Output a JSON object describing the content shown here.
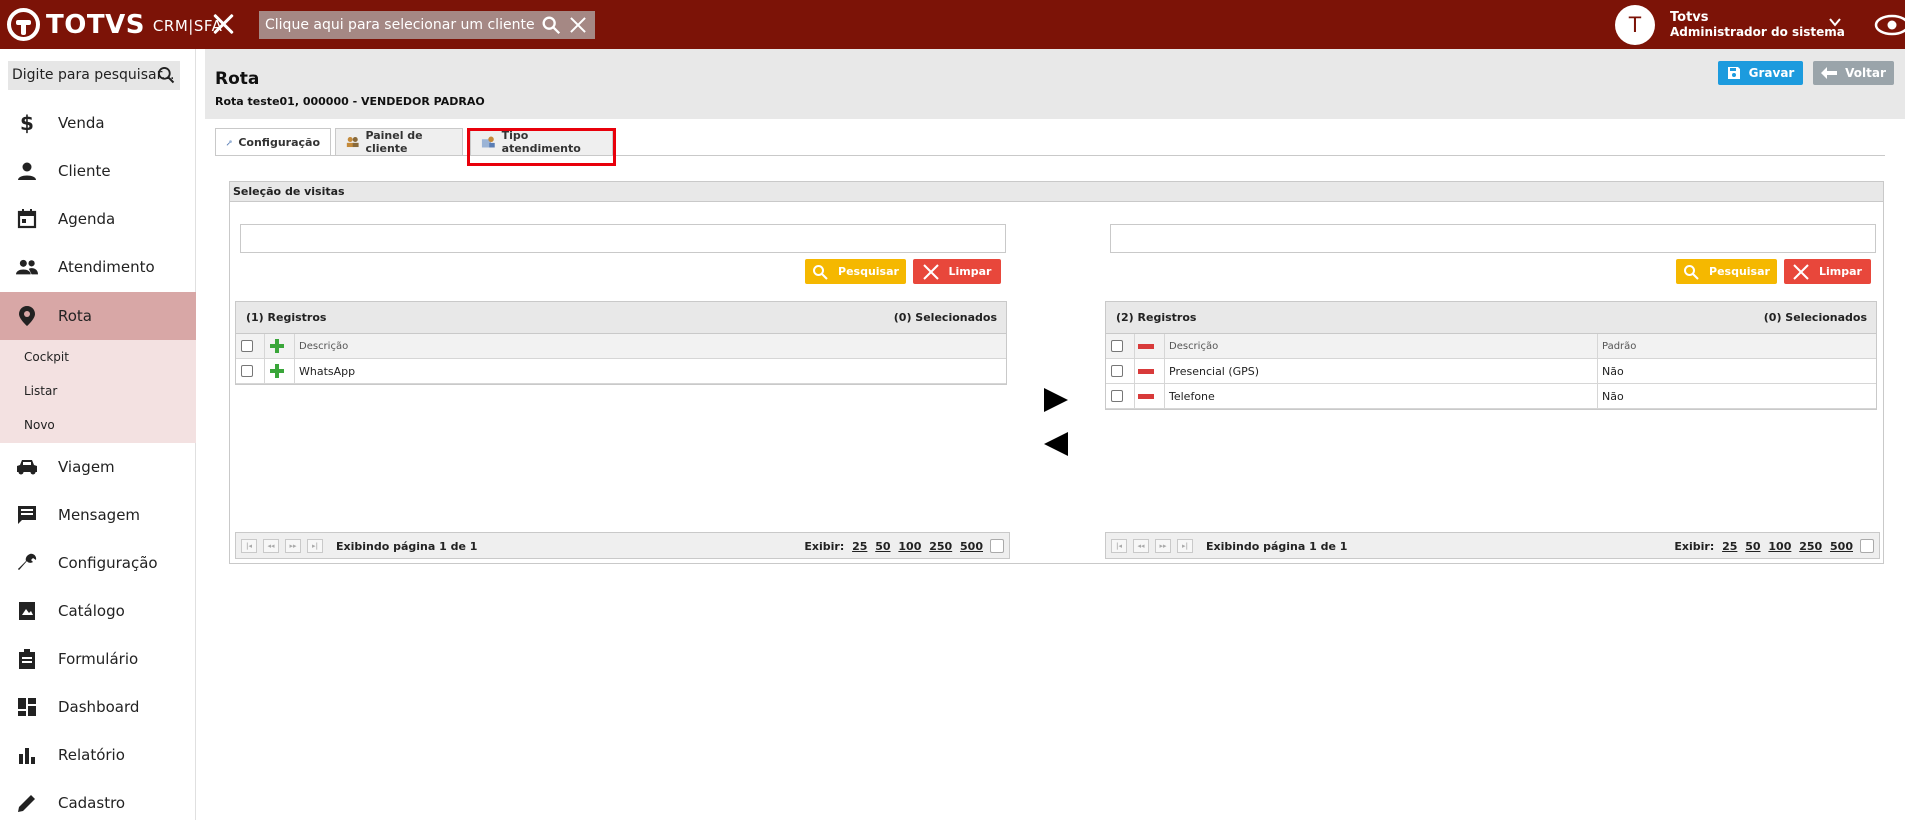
{
  "topbar": {
    "brand": "TOTVS",
    "brand_sub": "CRM|SFA",
    "client_placeholder": "Clique aqui para selecionar um cliente",
    "user_initial": "T",
    "user_name": "Totvs",
    "user_role": "Administrador do sistema"
  },
  "sidebar": {
    "search_placeholder": "Digite para pesquisar...",
    "items": [
      {
        "label": "Venda",
        "icon": "dollar-icon"
      },
      {
        "label": "Cliente",
        "icon": "person-icon"
      },
      {
        "label": "Agenda",
        "icon": "calendar-icon"
      },
      {
        "label": "Atendimento",
        "icon": "people-icon"
      },
      {
        "label": "Rota",
        "icon": "location-pin-icon"
      },
      {
        "label": "Viagem",
        "icon": "car-icon"
      },
      {
        "label": "Mensagem",
        "icon": "message-icon"
      },
      {
        "label": "Configuração",
        "icon": "wrench-icon"
      },
      {
        "label": "Catálogo",
        "icon": "catalog-icon"
      },
      {
        "label": "Formulário",
        "icon": "clipboard-icon"
      },
      {
        "label": "Dashboard",
        "icon": "dashboard-icon"
      },
      {
        "label": "Relatório",
        "icon": "bar-chart-icon"
      },
      {
        "label": "Cadastro",
        "icon": "pencil-icon"
      }
    ],
    "sub_items": [
      "Cockpit",
      "Listar",
      "Novo"
    ]
  },
  "header": {
    "title": "Rota",
    "subtitle": "Rota teste01, 000000 - VENDEDOR PADRAO",
    "save_label": "Gravar",
    "back_label": "Voltar"
  },
  "tabs": [
    {
      "label": "Configuração"
    },
    {
      "label": "Painel de cliente"
    },
    {
      "label": "Tipo atendimento"
    }
  ],
  "panel": {
    "title": "Seleção de visitas",
    "search_label": "Pesquisar",
    "clear_label": "Limpar",
    "left": {
      "count": "(1) Registros",
      "selected": "(0) Selecionados",
      "col_desc": "Descrição",
      "rows": [
        {
          "desc": "WhatsApp"
        }
      ],
      "page_info": "Exibindo página 1 de 1",
      "show": "Exibir:",
      "page_sizes": [
        "25",
        "50",
        "100",
        "250",
        "500"
      ]
    },
    "right": {
      "count": "(2) Registros",
      "selected": "(0) Selecionados",
      "col_desc": "Descrição",
      "col_default": "Padrão",
      "rows": [
        {
          "desc": "Presencial (GPS)",
          "default": "Não"
        },
        {
          "desc": "Telefone",
          "default": "Não"
        }
      ],
      "page_info": "Exibindo página 1 de 1",
      "show": "Exibir:",
      "page_sizes": [
        "25",
        "50",
        "100",
        "250",
        "500"
      ]
    }
  },
  "colors": {
    "topbar": "#7c1307",
    "active_nav": "#d8a7a6",
    "save_button": "#1c9bde",
    "search_button": "#f5b800",
    "clear_button": "#e8473b",
    "highlight": "#e8000b"
  }
}
